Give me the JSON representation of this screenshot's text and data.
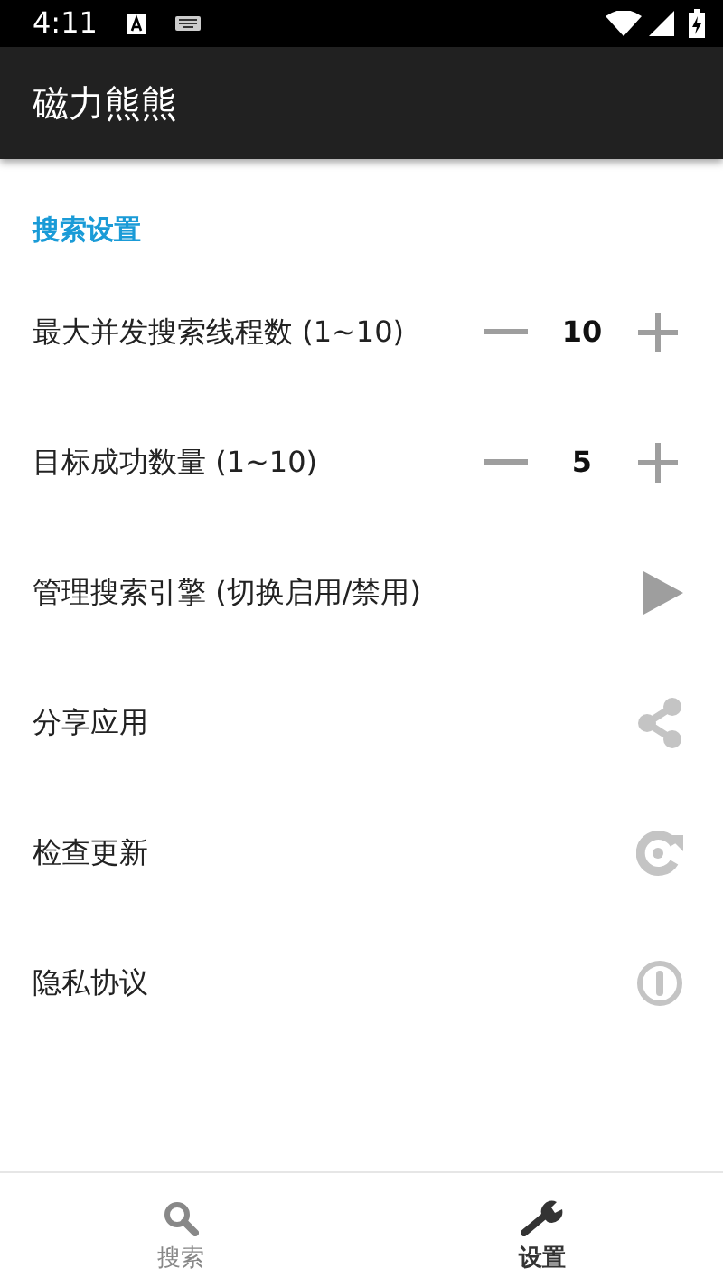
{
  "status_bar": {
    "time": "4:11"
  },
  "app_bar": {
    "title": "磁力熊熊"
  },
  "section": {
    "title": "搜索设置"
  },
  "items": [
    {
      "kind": "stepper",
      "label": "最大并发搜索线程数 (1~10)",
      "value": "10"
    },
    {
      "kind": "stepper",
      "label": "目标成功数量 (1~10)",
      "value": "5"
    },
    {
      "kind": "play",
      "label": "管理搜索引擎 (切换启用/禁用)"
    },
    {
      "kind": "share",
      "label": "分享应用"
    },
    {
      "kind": "refresh",
      "label": "检查更新"
    },
    {
      "kind": "info",
      "label": "隐私协议"
    }
  ],
  "bottom_nav": [
    {
      "kind": "search",
      "label": "搜索",
      "selected": false
    },
    {
      "kind": "wrench",
      "label": "设置",
      "selected": true
    }
  ]
}
